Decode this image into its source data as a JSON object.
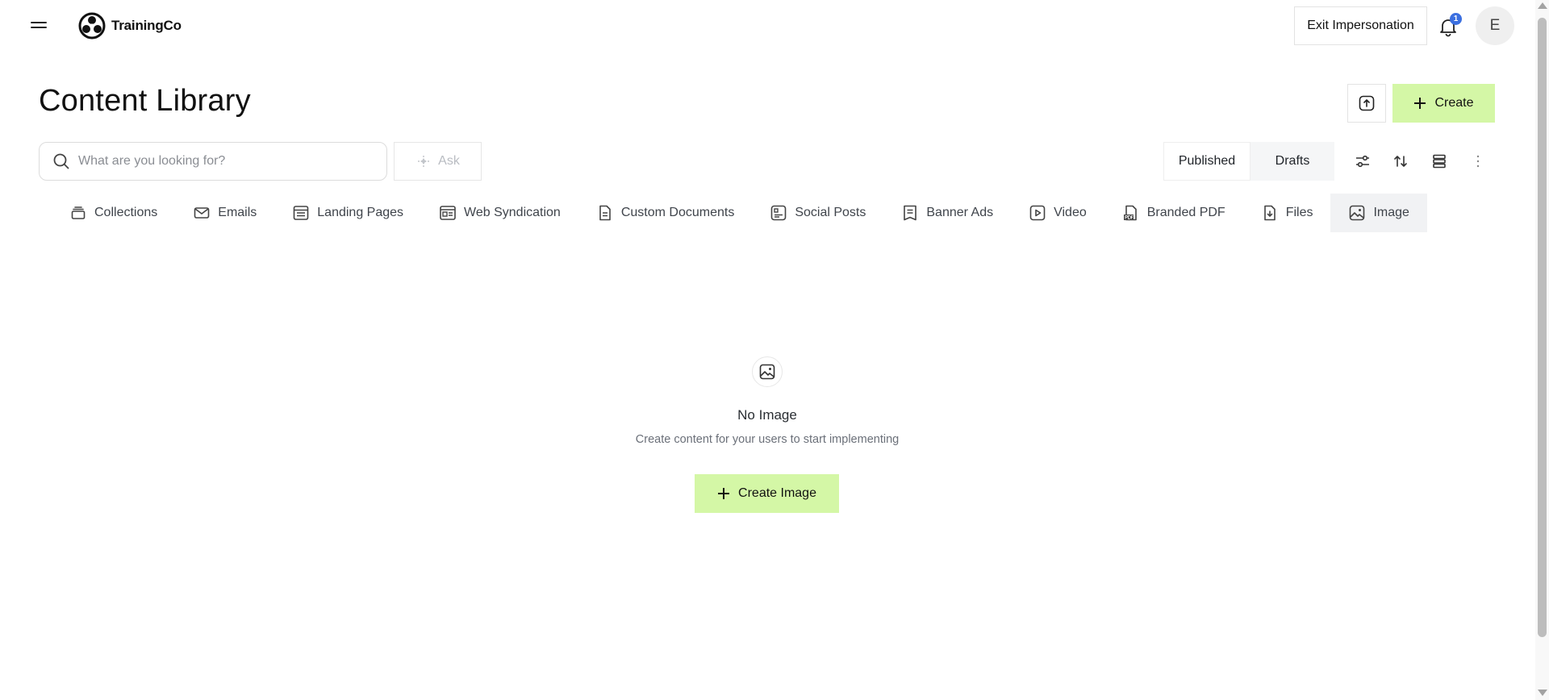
{
  "header": {
    "brand": "TrainingCo",
    "exit_label": "Exit Impersonation",
    "notification_count": "1",
    "avatar_initial": "E"
  },
  "page": {
    "title": "Content Library",
    "create_label": "Create"
  },
  "search": {
    "placeholder": "What are you looking for?",
    "ask_label": "Ask"
  },
  "status_toggle": {
    "published": "Published",
    "drafts": "Drafts",
    "active": "Published"
  },
  "tabs": [
    {
      "label": "Collections",
      "icon": "collections-icon"
    },
    {
      "label": "Emails",
      "icon": "mail-icon"
    },
    {
      "label": "Landing Pages",
      "icon": "landing-page-icon"
    },
    {
      "label": "Web Syndication",
      "icon": "web-syndication-icon"
    },
    {
      "label": "Custom Documents",
      "icon": "document-icon"
    },
    {
      "label": "Social Posts",
      "icon": "social-post-icon"
    },
    {
      "label": "Banner Ads",
      "icon": "banner-icon"
    },
    {
      "label": "Video",
      "icon": "video-icon"
    },
    {
      "label": "Branded PDF",
      "icon": "pdf-icon"
    },
    {
      "label": "Files",
      "icon": "file-icon"
    },
    {
      "label": "Image",
      "icon": "image-icon",
      "active": true
    }
  ],
  "empty_state": {
    "title": "No Image",
    "description": "Create content for your users to start implementing",
    "button_label": "Create Image"
  },
  "colors": {
    "accent_green": "#d4f7a6",
    "badge_blue": "#3b6fe0"
  }
}
